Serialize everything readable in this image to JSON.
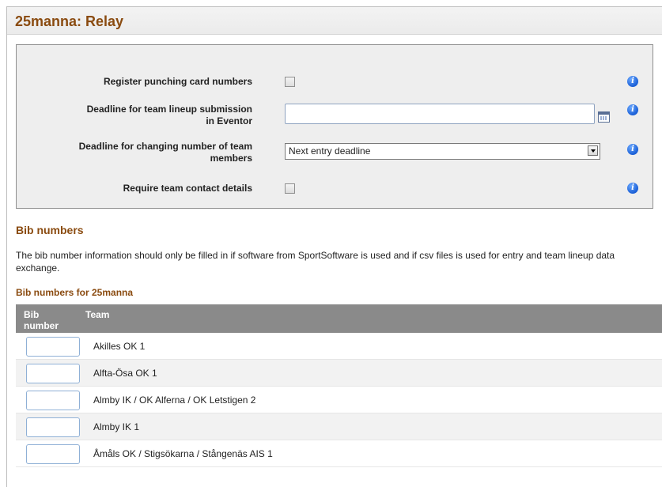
{
  "page": {
    "title": "25manna: Relay"
  },
  "settings": {
    "register_punch": {
      "label": "Register punching card numbers",
      "checked": false
    },
    "deadline_lineup": {
      "label_line1": "Deadline for team lineup submission",
      "label_line2": "in Eventor",
      "value": ""
    },
    "deadline_members": {
      "label_line1": "Deadline for changing number of team",
      "label_line2": "members",
      "selected": "Next entry deadline"
    },
    "require_contact": {
      "label": "Require team contact details",
      "checked": false
    },
    "info_glyph": "i"
  },
  "bib": {
    "heading": "Bib numbers",
    "description": "The bib number information should only be filled in if software from SportSoftware is used and if csv files is used for entry and team lineup data exchange.",
    "subheading": "Bib numbers for 25manna",
    "columns": {
      "bib_line1": "Bib",
      "bib_line2": "number",
      "team": "Team"
    },
    "rows": [
      {
        "bib": "",
        "team": "Akilles OK 1"
      },
      {
        "bib": "",
        "team": "Alfta-Ösa OK 1"
      },
      {
        "bib": "",
        "team": "Almby IK / OK Alferna / OK Letstigen 2"
      },
      {
        "bib": "",
        "team": "Almby IK 1"
      },
      {
        "bib": "",
        "team": "Åmåls OK / Stigsökarna / Stångenäs AIS 1"
      }
    ]
  },
  "colors": {
    "heading": "#8a4b10",
    "table_header": "#8a8a8a",
    "info_icon": "#1a5fd6"
  }
}
